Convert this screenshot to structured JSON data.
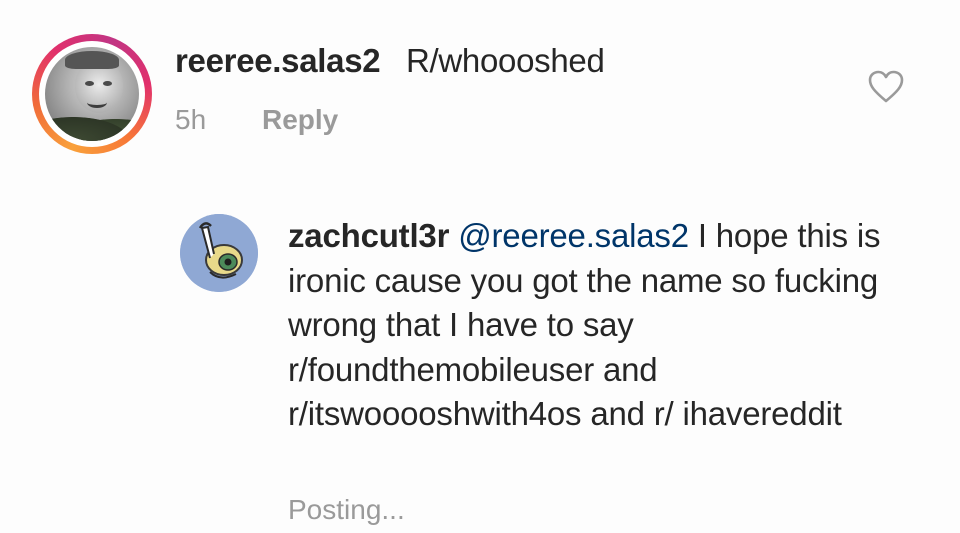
{
  "comment": {
    "username": "reeree.salas2",
    "text": "R/whoooshed",
    "time": "5h",
    "reply_label": "Reply",
    "like_icon": "heart-outline-icon"
  },
  "reply": {
    "username": "zachcutl3r",
    "mention": "@reeree.salas2",
    "lines": [
      " I hope this is ironic cause you got the name so fucking wrong that I have to say r/foundthemobileuser and r/itswooooshwith4os and r/ ihavereddit"
    ],
    "status": "Posting..."
  },
  "colors": {
    "text": "#262626",
    "muted": "#9a9a9a",
    "mention": "#003569",
    "background": "#fdfdfd"
  }
}
